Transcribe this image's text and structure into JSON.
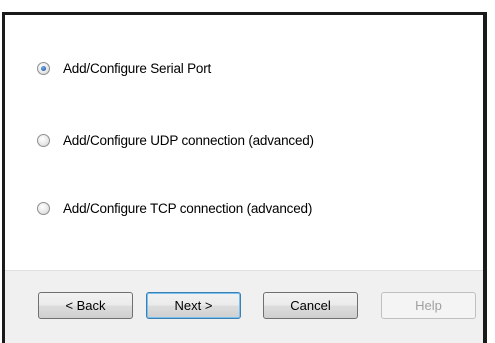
{
  "options": [
    {
      "label": "Add/Configure Serial Port",
      "checked": true
    },
    {
      "label": "Add/Configure UDP connection (advanced)",
      "checked": false
    },
    {
      "label": "Add/Configure TCP connection (advanced)",
      "checked": false
    }
  ],
  "buttons": {
    "back": "< Back",
    "next": "Next >",
    "cancel": "Cancel",
    "help": "Help"
  }
}
